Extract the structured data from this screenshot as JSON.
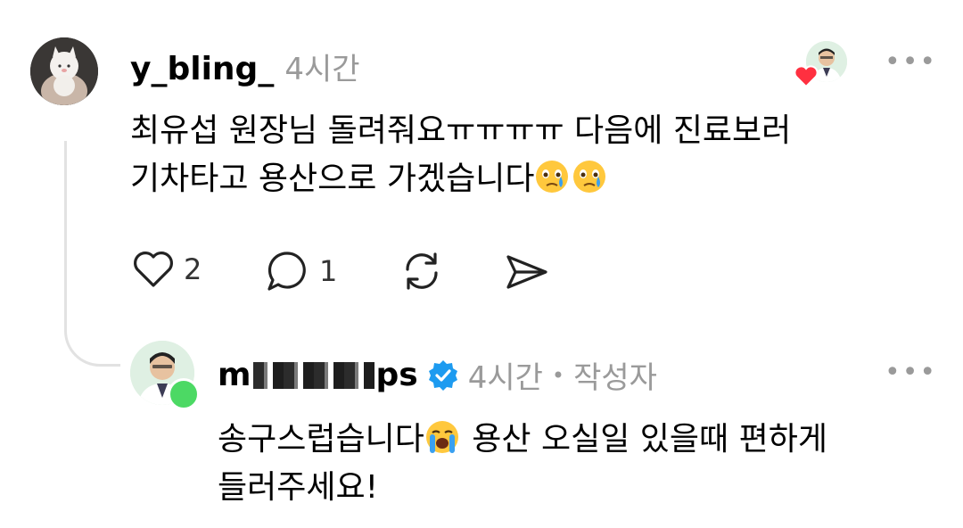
{
  "comment": {
    "username": "y_bling_",
    "time": "4시간",
    "text_line1": "최유섭 원장님 돌려줘요ㅠㅠㅠㅠ 다음에 진료보러",
    "text_line2": "기차타고 용산으로 가겠습니다",
    "line2_emojis": [
      "face-holding-back-tears-emoji",
      "face-holding-back-tears-emoji"
    ],
    "like_count": "2",
    "reply_count": "1"
  },
  "reply": {
    "username_prefix": "m",
    "username_suffix": "ps",
    "time": "4시간",
    "separator": "•",
    "author_tag": "작성자",
    "text_line1_part1": "송구스럽습니다",
    "text_line1_emoji": "loudly-crying-face-emoji",
    "text_line1_part2": " 용산 오실일 있을때 편하게",
    "text_line2": "들러주세요!"
  },
  "more_label": "•••",
  "colors": {
    "verified": "#1d9bf0",
    "heart": "#ff3040",
    "online": "#4cd964",
    "muted": "#9a9a9a"
  }
}
